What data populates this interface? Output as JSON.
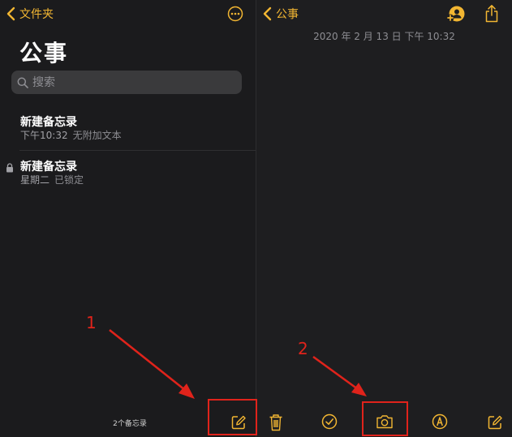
{
  "left_pane": {
    "back_label": "文件夹",
    "title": "公事",
    "search_placeholder": "搜索",
    "notes": [
      {
        "title": "新建备忘录",
        "time": "下午10:32",
        "preview": "无附加文本",
        "locked": false
      },
      {
        "title": "新建备忘录",
        "time": "星期二",
        "preview": "已锁定",
        "locked": true
      }
    ],
    "footer_count": "2个备忘录"
  },
  "right_pane": {
    "back_label": "公事",
    "date": "2020 年 2 月 13 日 下午 10:32"
  },
  "annotations": [
    {
      "label": "1"
    },
    {
      "label": "2"
    }
  ],
  "colors": {
    "accent": "#f2b632",
    "background": "#1c1c1e",
    "annotation": "#e0231b"
  },
  "icons": [
    "chevron-left-icon",
    "ellipsis-circle-icon",
    "search-icon",
    "lock-icon",
    "compose-icon",
    "add-person-icon",
    "share-icon",
    "trash-icon",
    "checklist-icon",
    "camera-icon",
    "markup-icon"
  ]
}
